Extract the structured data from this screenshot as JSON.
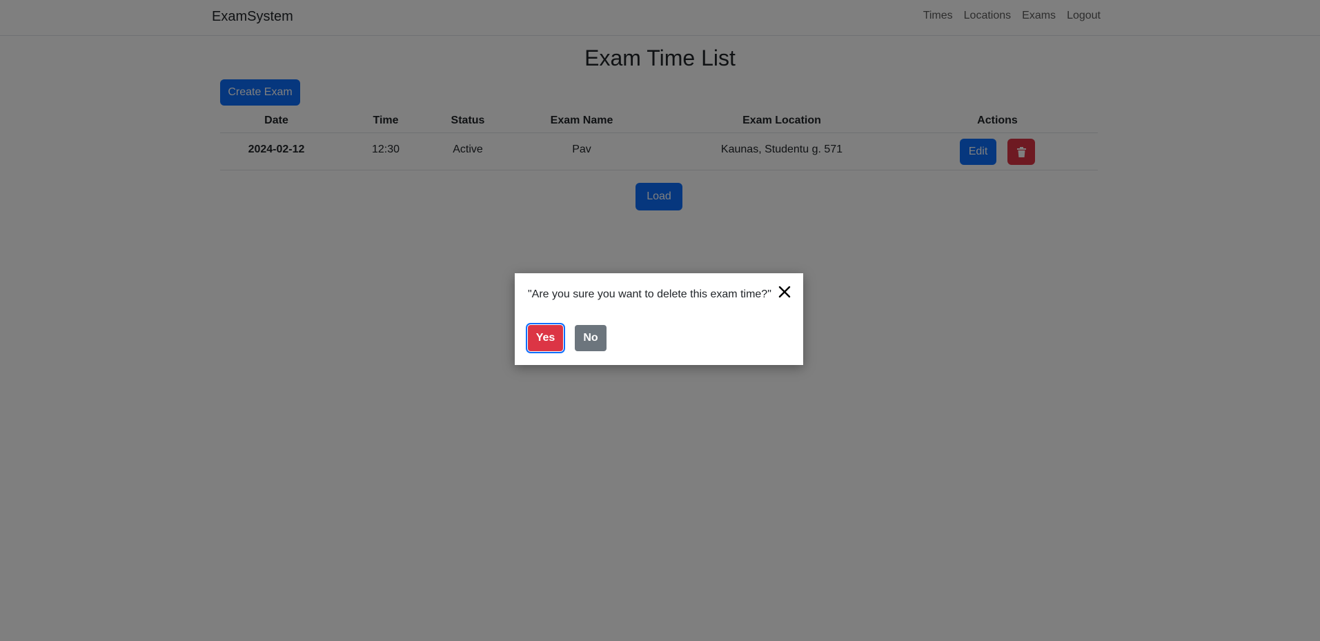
{
  "navbar": {
    "brand": "ExamSystem",
    "links": [
      "Times",
      "Locations",
      "Exams",
      "Logout"
    ]
  },
  "page": {
    "title": "Exam Time List",
    "create_button": "Create Exam",
    "load_button": "Load"
  },
  "table": {
    "headers": [
      "Date",
      "Time",
      "Status",
      "Exam Name",
      "Exam Location",
      "Actions"
    ],
    "rows": [
      {
        "date": "2024-02-12",
        "time": "12:30",
        "status": "Active",
        "exam_name": "Pav",
        "exam_location": "Kaunas, Studentu g. 571",
        "edit_label": "Edit"
      }
    ]
  },
  "dialog": {
    "message": "\"Are you sure you want to delete this exam time?\"",
    "yes_label": "Yes",
    "no_label": "No"
  },
  "colors": {
    "primary": "#0d6efd",
    "danger": "#dc3545",
    "secondary": "#6c757d",
    "overlay": "rgba(0,0,0,0.5)"
  }
}
